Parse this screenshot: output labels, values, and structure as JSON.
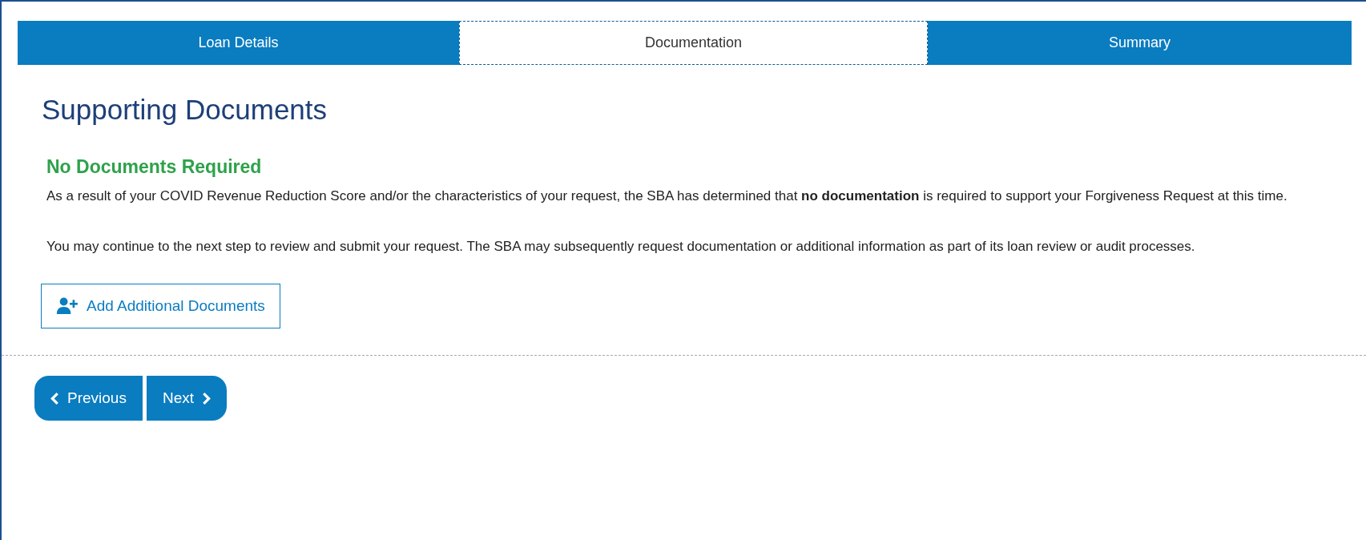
{
  "tabs": [
    {
      "label": "Loan Details",
      "selected": false
    },
    {
      "label": "Documentation",
      "selected": true
    },
    {
      "label": "Summary",
      "selected": false
    }
  ],
  "heading": "Supporting Documents",
  "notice": {
    "title": "No Documents Required",
    "paragraphs": [
      "As a result of your COVID Revenue Reduction Score and/or the characteristics of your request, the SBA has determined that **no documentation** is required to support your Forgiveness Request at this time.",
      "You may continue to the next step to review and submit your request. The SBA may subsequently request documentation or additional information as part of its loan review or audit processes."
    ]
  },
  "add_button": "Add Additional Documents",
  "nav_buttons": [
    {
      "kind": "previous",
      "label": "Previous"
    },
    {
      "kind": "next",
      "label": "Next"
    }
  ]
}
